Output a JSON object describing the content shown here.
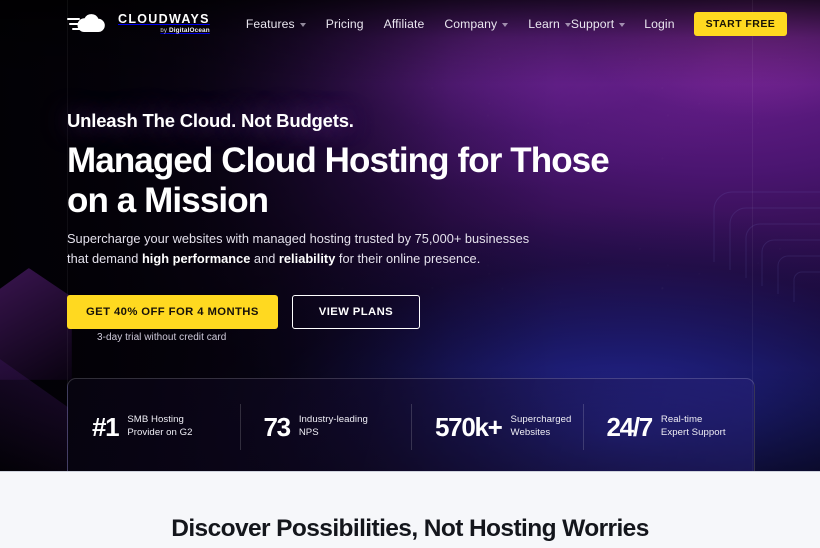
{
  "brand": {
    "logo_name": "CLOUDWAYS",
    "logo_sub_prefix": "by",
    "logo_sub_name": "DigitalOcean",
    "accent_yellow": "#ffd920",
    "hero_bg_dark": "#050208",
    "hero_bg_purple": "#6d1f8f",
    "hero_bg_blue": "#282caa",
    "section_bg": "#f6f7fa"
  },
  "nav": {
    "main_items": [
      {
        "label": "Features",
        "has_dropdown": true
      },
      {
        "label": "Pricing",
        "has_dropdown": false
      },
      {
        "label": "Affiliate",
        "has_dropdown": false
      },
      {
        "label": "Company",
        "has_dropdown": true
      },
      {
        "label": "Learn",
        "has_dropdown": true
      }
    ],
    "right_items": [
      {
        "label": "Support",
        "has_dropdown": true
      },
      {
        "label": "Login",
        "has_dropdown": false
      }
    ],
    "cta_label": "START FREE"
  },
  "hero": {
    "eyebrow": "Unleash The Cloud. Not Budgets.",
    "headline": "Managed Cloud Hosting for Those on a Mission",
    "subhead_part1": "Supercharge your websites with managed hosting trusted by 75,000+ businesses that demand ",
    "subhead_bold1": "high performance",
    "subhead_part2": " and ",
    "subhead_bold2": "reliability",
    "subhead_part3": " for their online presence.",
    "primary_cta": "GET 40% OFF FOR 4 MONTHS",
    "secondary_cta": "VIEW PLANS",
    "trial_note": "3-day trial without credit card"
  },
  "stats": [
    {
      "value": "#1",
      "label_line1": "SMB Hosting",
      "label_line2": "Provider on G2"
    },
    {
      "value": "73",
      "label_line1": "Industry-leading",
      "label_line2": "NPS"
    },
    {
      "value": "570k+",
      "label_line1": "Supercharged",
      "label_line2": "Websites"
    },
    {
      "value": "24/7",
      "label_line1": "Real-time",
      "label_line2": "Expert Support"
    }
  ],
  "section": {
    "heading": "Discover Possibilities, Not Hosting Worries"
  }
}
